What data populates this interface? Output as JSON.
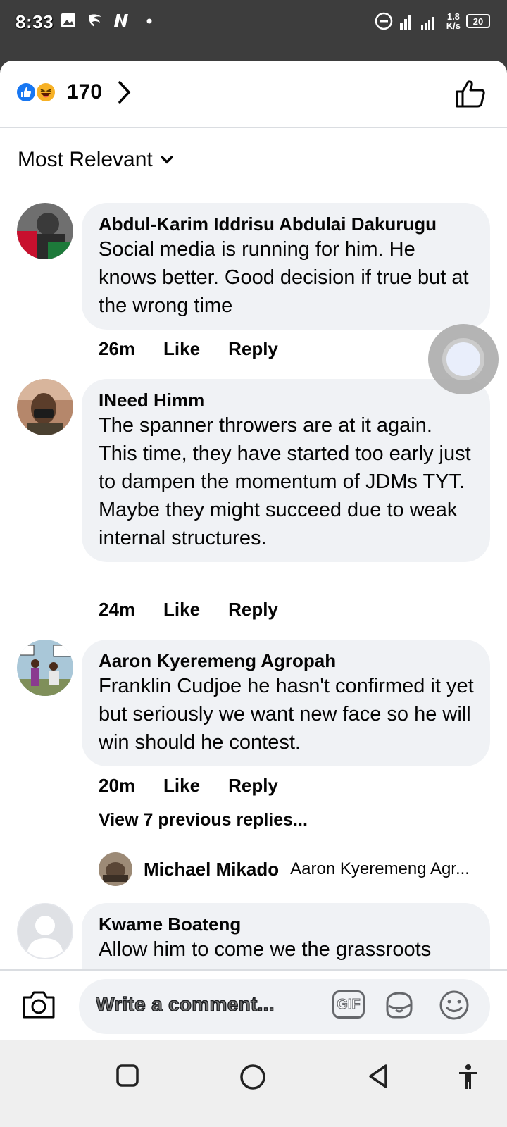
{
  "status_bar": {
    "time": "8:33",
    "network_speed_value": "1.8",
    "network_speed_unit": "K/s",
    "battery": "20",
    "icons": [
      "gallery-icon",
      "app-icon",
      "netflix-icon",
      "dot-icon",
      "dnd-icon",
      "signal-icon",
      "battery-icon"
    ]
  },
  "reactions": {
    "count": "170",
    "types": [
      "like",
      "haha"
    ]
  },
  "sort": {
    "label": "Most Relevant"
  },
  "comments": [
    {
      "author": "Abdul-Karim Iddrisu Abdulai Dakurugu",
      "text": "Social media is running for him. He knows better. Good decision if true but at the wrong time",
      "time": "26m",
      "like": "Like",
      "reply": "Reply"
    },
    {
      "author": "INeed Himm",
      "text": "The spanner throwers are at it again. This time, they have started too early just to dampen the momentum of JDMs TYT.\nMaybe they might succeed due to weak internal structures.",
      "time": "24m",
      "like": "Like",
      "reply": "Reply"
    },
    {
      "author": "Aaron Kyeremeng Agropah",
      "text": "Franklin Cudjoe he hasn't confirmed it yet but seriously we want new face so he will win should he contest.",
      "time": "20m",
      "like": "Like",
      "reply": "Reply"
    },
    {
      "author": "Kwame Boateng",
      "text": "Allow him to come we the grassroots"
    }
  ],
  "replies": {
    "view_previous": "View 7 previous replies...",
    "latest_author": "Michael Mikado",
    "latest_text": "Aaron Kyeremeng Agr..."
  },
  "composer": {
    "placeholder": "Write a comment...",
    "gif_label": "GIF"
  },
  "colors": {
    "like_blue": "#1877f2",
    "bubble_bg": "#f0f2f5",
    "status_bar_bg": "#3d3d3d"
  }
}
